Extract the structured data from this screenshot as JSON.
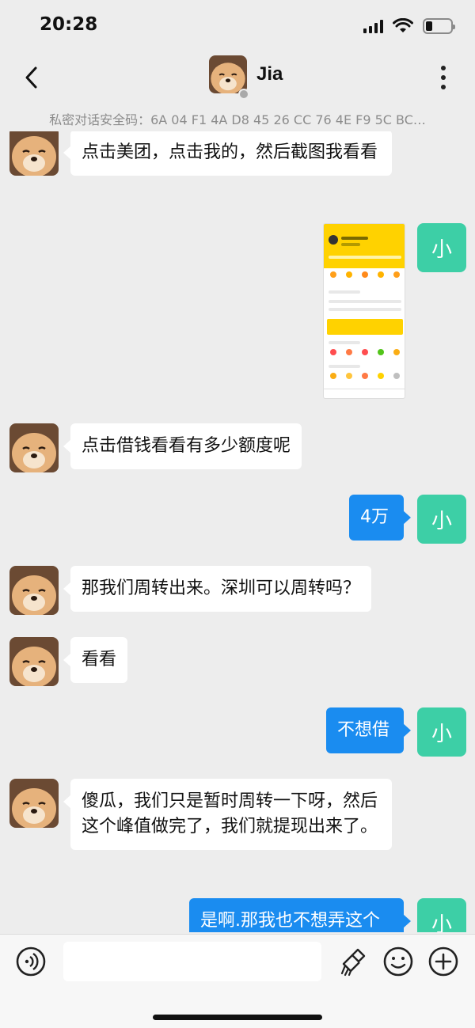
{
  "status_bar": {
    "time": "20:28",
    "battery_level": 0.28
  },
  "header": {
    "contact_name": "Jia",
    "back_icon": "chevron-left-icon",
    "more_icon": "more-vertical-icon"
  },
  "security_code": "私密对话安全码：6A 04 F1 4A D8 45 26 CC 76 4E F9 5C BC…",
  "me_avatar_label": "小",
  "messages": [
    {
      "from": "them",
      "text": "点击美团，点击我的，然后截图我看看"
    },
    {
      "from": "me",
      "type": "image",
      "description_icon": "screenshot-thumbnail"
    },
    {
      "from": "them",
      "text": "点击借钱看看有多少额度呢"
    },
    {
      "from": "me",
      "text": "4万"
    },
    {
      "from": "them",
      "text": "那我们周转出来。深圳可以周转吗？"
    },
    {
      "from": "them",
      "text": "看看"
    },
    {
      "from": "me",
      "text": "不想借"
    },
    {
      "from": "them",
      "text": "傻瓜，我们只是暂时周转一下呀，然后这个峰值做完了，我们就提现出来了。"
    },
    {
      "from": "me",
      "text": "是啊.那我也不想弄这个"
    }
  ],
  "input_bar": {
    "voice_icon": "voice-icon",
    "clean_icon": "brush-icon",
    "emoji_icon": "emoji-icon",
    "add_icon": "plus-circle-icon",
    "placeholder": ""
  },
  "colors": {
    "bubble_out": "#1a8cf0",
    "avatar_me": "#3dcfa6",
    "background": "#ededed"
  }
}
